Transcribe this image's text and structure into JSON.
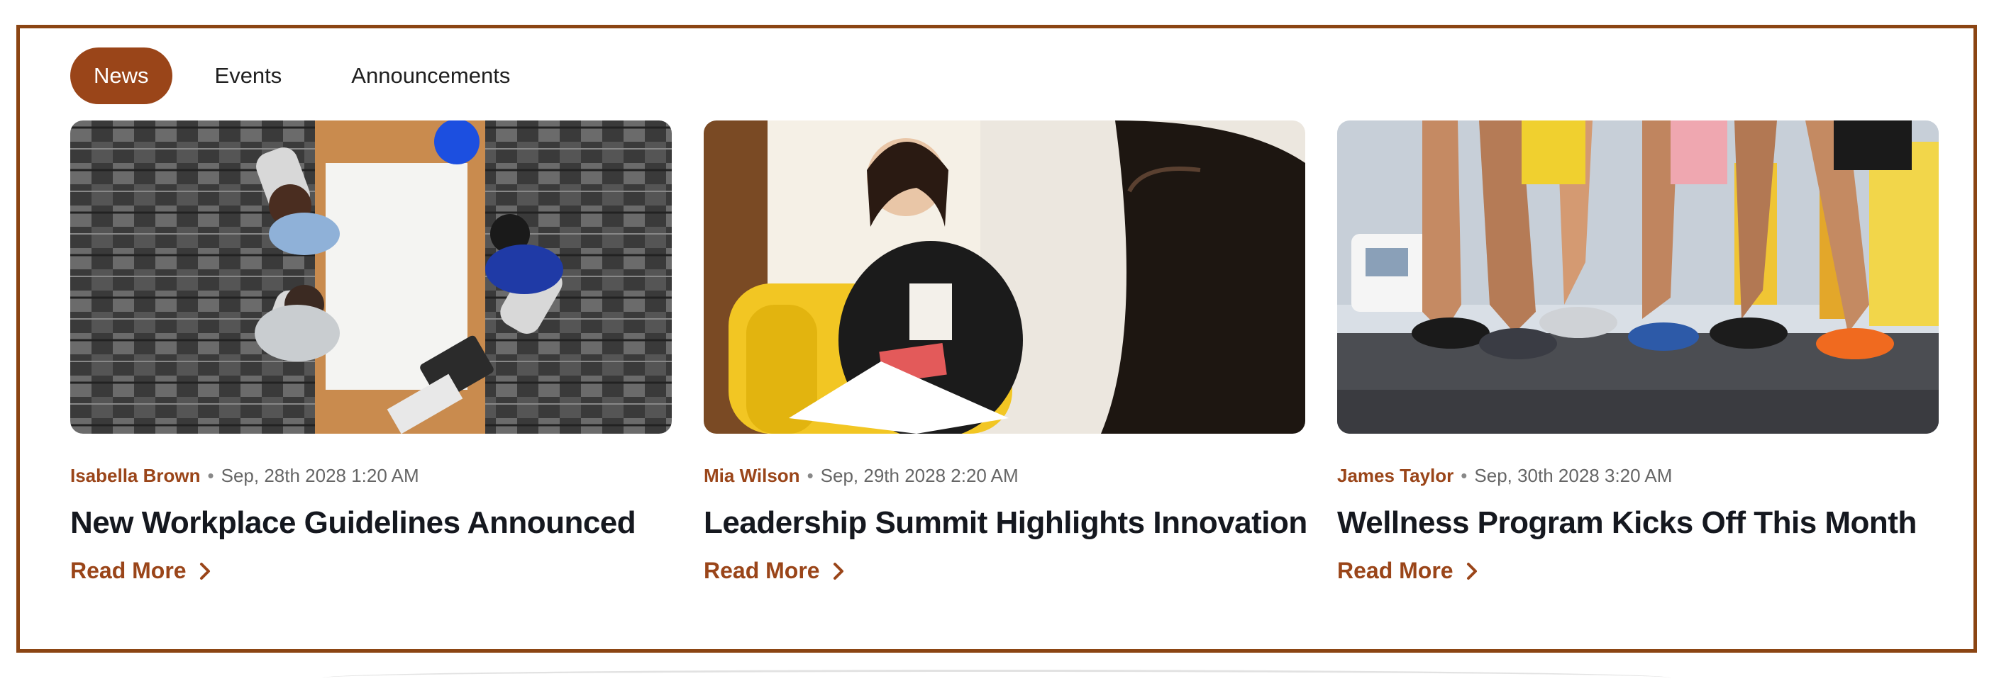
{
  "tabs": [
    {
      "label": "News",
      "active": true
    },
    {
      "label": "Events",
      "active": false
    },
    {
      "label": "Announcements",
      "active": false
    }
  ],
  "cards": [
    {
      "image": "office-meeting-overhead-photo",
      "author": "Isabella Brown",
      "date": "Sep, 28th 2028 1:20 AM",
      "title": "New Workplace Guidelines Announced",
      "read_more": "Read More"
    },
    {
      "image": "leadership-conversation-photo",
      "author": "Mia Wilson",
      "date": "Sep, 29th 2028 2:20 AM",
      "title": "Leadership Summit Highlights Innovation",
      "read_more": "Read More"
    },
    {
      "image": "runners-race-photo",
      "author": "James Taylor",
      "date": "Sep, 30th 2028 3:20 AM",
      "title": "Wellness Program Kicks Off This Month",
      "read_more": "Read More"
    }
  ],
  "colors": {
    "accent": "#9a4519",
    "border": "#8B4513"
  }
}
